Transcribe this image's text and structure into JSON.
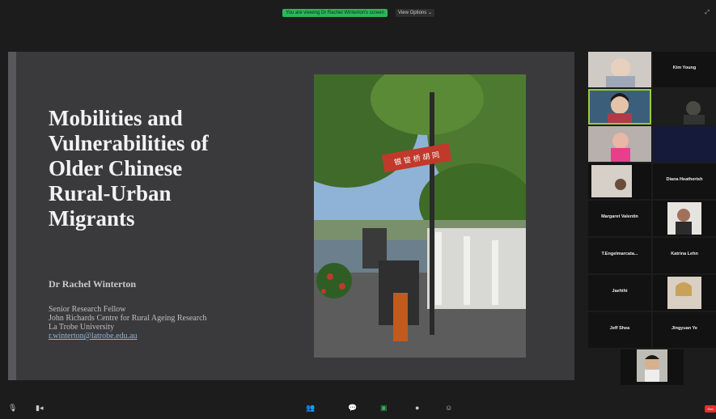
{
  "topbar": {
    "share_banner": "You are viewing Dr Rachel Winterton's screen",
    "view_options": "View Options ⌄",
    "expand_icon": "expand-icon"
  },
  "slide": {
    "title_lines": [
      "Mobilities and",
      "Vulnerabilities of",
      "Older Chinese",
      "Rural-Urban",
      "Migrants"
    ],
    "author": "Dr Rachel Winterton",
    "affiliation": [
      "Senior Research Fellow",
      "John Richards Centre for Rural Ageing Research",
      "La Trobe University"
    ],
    "email": "r.winterton@latrobe.edu.au",
    "photo_sign_text": "银 锭 桥 胡 同"
  },
  "participants": [
    {
      "name": "",
      "type": "video"
    },
    {
      "name": "Kim Young",
      "type": "name"
    },
    {
      "name": "",
      "type": "video",
      "active": true
    },
    {
      "name": "",
      "type": "video-dark"
    },
    {
      "name": "",
      "type": "video"
    },
    {
      "name": "",
      "type": "blank-blue"
    },
    {
      "name": "",
      "type": "video"
    },
    {
      "name": "Diana Heatherish",
      "type": "name"
    },
    {
      "name": "Margaret Valentin",
      "type": "name"
    },
    {
      "name": "",
      "type": "video"
    },
    {
      "name": "T.Engelmarcata...",
      "type": "name"
    },
    {
      "name": "Katrina Lehn",
      "type": "name"
    },
    {
      "name": "Jaehihi",
      "type": "name"
    },
    {
      "name": "",
      "type": "video"
    },
    {
      "name": "Jeff Shea",
      "type": "name"
    },
    {
      "name": "Jingyuan Ye",
      "type": "name"
    },
    {
      "name": "",
      "type": "video"
    }
  ],
  "toolbar": {
    "mute_icon": "microphone-icon",
    "video_icon": "video-camera-icon",
    "participants_icon": "participants-icon",
    "chat_icon": "chat-icon",
    "share_icon": "share-screen-icon",
    "record_icon": "record-icon",
    "reactions_icon": "reactions-icon",
    "end": "End"
  }
}
